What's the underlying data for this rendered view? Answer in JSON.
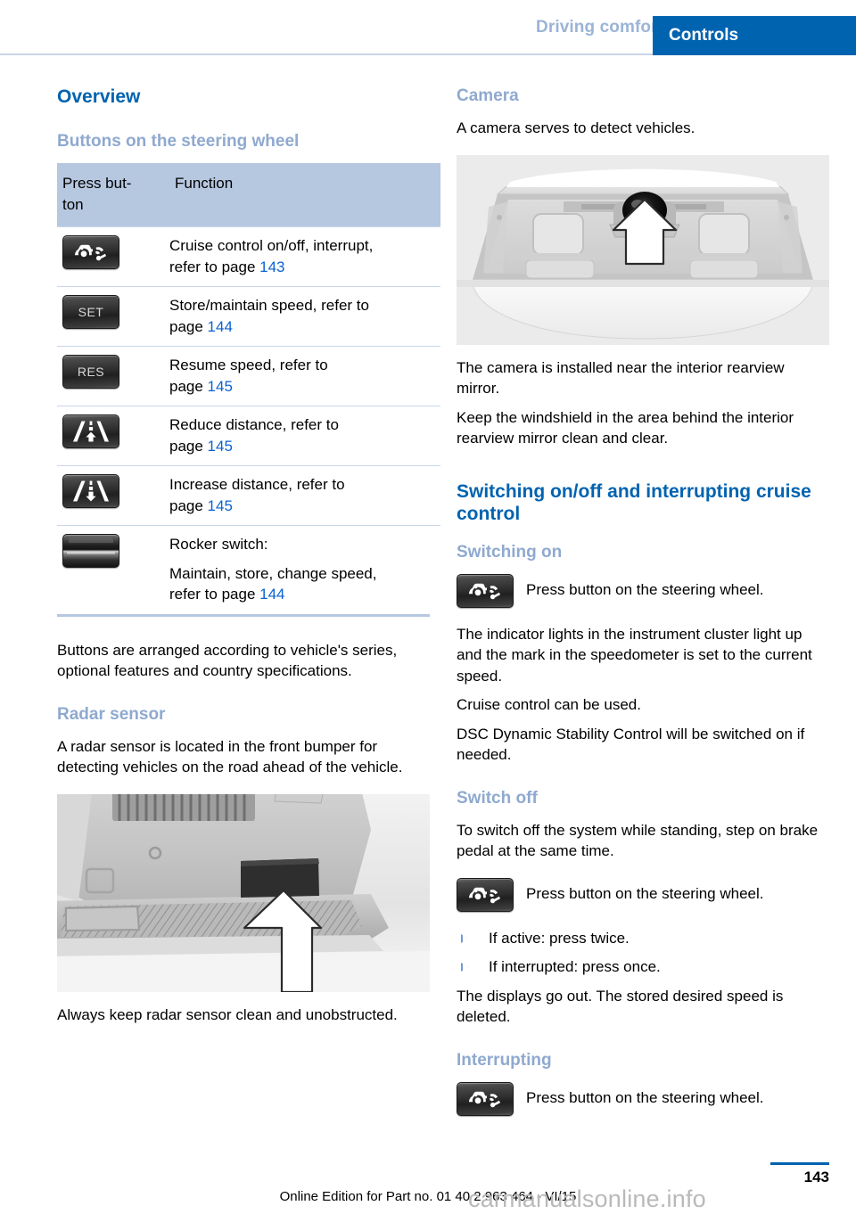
{
  "header": {
    "chapter": "Driving comfort",
    "section": "Controls"
  },
  "left_column": {
    "title": "Overview",
    "subtitle": "Buttons on the steering wheel",
    "table": {
      "columns": [
        "Press but-\nton",
        "Function"
      ],
      "col_icon_header": "Press but-",
      "col_icon_header2": "ton",
      "col_func_header": "Function",
      "rows": [
        {
          "icon": "cruise-control-button-icon",
          "icon_label": "",
          "line1": "Cruise control on/off, interrupt,",
          "line2_prefix": "refer to page ",
          "line2_page": "143"
        },
        {
          "icon": "set-button-icon",
          "icon_label": "SET",
          "line1": "Store/maintain speed, refer to",
          "line2_prefix": "page ",
          "line2_page": "144"
        },
        {
          "icon": "res-button-icon",
          "icon_label": "RES",
          "line1": "Resume speed, refer to",
          "line2_prefix": "page ",
          "line2_page": "145"
        },
        {
          "icon": "reduce-distance-button-icon",
          "icon_label": "",
          "line1": "Reduce distance, refer to",
          "line2_prefix": "page ",
          "line2_page": "145"
        },
        {
          "icon": "increase-distance-button-icon",
          "icon_label": "",
          "line1": "Increase distance, refer to",
          "line2_prefix": "page ",
          "line2_page": "145"
        },
        {
          "icon": "rocker-switch-icon",
          "icon_label": "",
          "line0": "Rocker switch:",
          "line1": "Maintain, store, change speed,",
          "line2_prefix": "refer to page ",
          "line2_page": "144"
        }
      ]
    },
    "note_after_table": "Buttons are arranged according to vehicle's series, optional features and country specifications.",
    "radar_heading": "Radar sensor",
    "radar_text": "A radar sensor is located in the front bumper for detecting vehicles on the road ahead of the vehicle.",
    "radar_caption": "Always keep radar sensor clean and unobstructed.",
    "radar_figure_name": "front-bumper-radar-sensor-photo"
  },
  "right_column": {
    "camera_heading": "Camera",
    "camera_intro": "A camera serves to detect vehicles.",
    "camera_figure_name": "windshield-camera-photo",
    "camera_text_1": "The camera is installed near the interior rearview mirror.",
    "camera_text_2": "Keep the windshield in the area behind the interior rearview mirror clean and clear.",
    "switching_heading": "Switching on/off and interrupting cruise control",
    "switching_on_heading": "Switching on",
    "switching_on_button_text": "Press button on the steering wheel.",
    "switching_on_text_1": "The indicator lights in the instrument cluster light up and the mark in the speedometer is set to the current speed.",
    "switching_on_text_2": "Cruise control can be used.",
    "switching_on_text_3": "DSC Dynamic Stability Control will be switched on if needed.",
    "switch_off_heading": "Switch off",
    "switch_off_text_1": "To switch off the system while standing, step on brake pedal at the same time.",
    "switch_off_button_text": "Press button on the steering wheel.",
    "switch_off_bullets": [
      "If active: press twice.",
      "If interrupted: press once."
    ],
    "switch_off_text_2": "The displays go out. The stored desired speed is deleted.",
    "interrupting_heading": "Interrupting",
    "interrupting_button_text": "Press button on the steering wheel."
  },
  "footer": {
    "page_number": "143",
    "edition": "Online Edition for Part no. 01 40 2 963 464 - VI/15",
    "watermark": "carmanualsonline.info"
  },
  "colors": {
    "accent_blue": "#0063b0",
    "light_blue_heading": "#8fa9cf",
    "table_header_bg": "#b6c7e0",
    "page_ref_blue": "#0b62d1"
  }
}
